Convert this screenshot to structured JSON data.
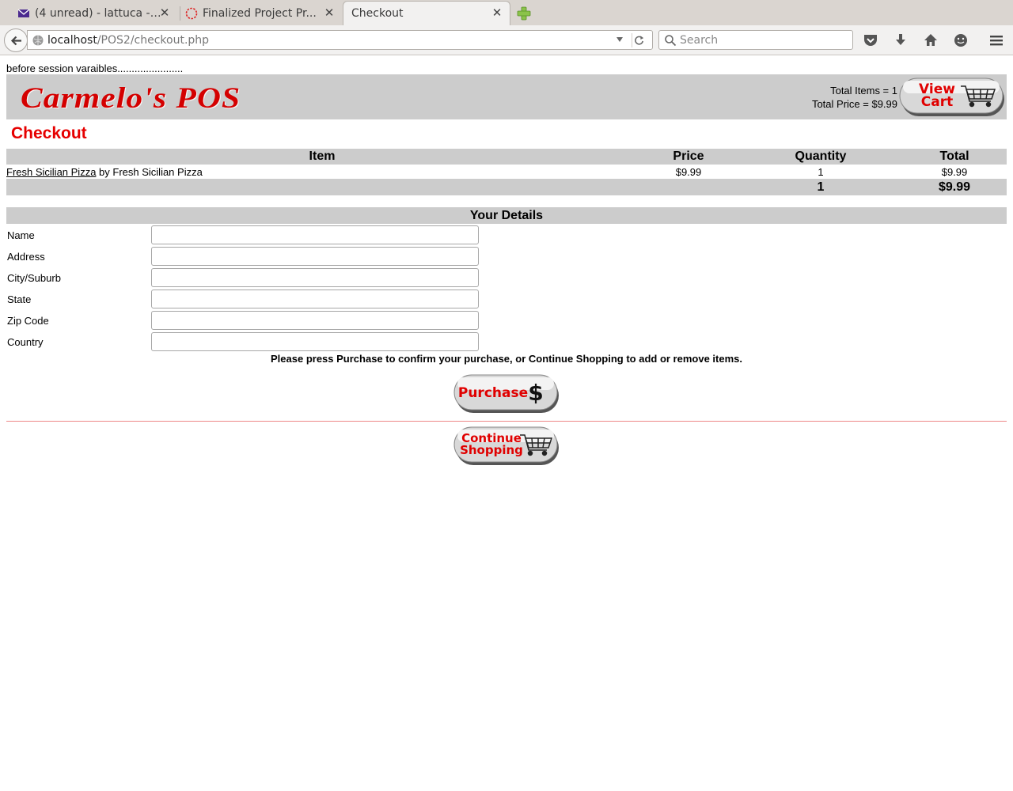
{
  "browser": {
    "tabs": [
      {
        "title": "(4 unread) - lattuca - ...",
        "icon": "mail-icon"
      },
      {
        "title": "Finalized Project Pr...",
        "icon": "loading-icon"
      },
      {
        "title": "Checkout",
        "icon": "none"
      }
    ],
    "url": {
      "host": "localhost",
      "path": "/POS2/checkout.php"
    },
    "search_placeholder": "Search"
  },
  "page": {
    "debug_text": "before session varaibles.......................",
    "logo": "Carmelo's POS",
    "cart": {
      "total_items": "Total Items = 1",
      "total_price": "Total Price = $9.99",
      "view_cart_line1": "View",
      "view_cart_line2": "Cart"
    },
    "title": "Checkout",
    "table": {
      "headers": {
        "item": "Item",
        "price": "Price",
        "quantity": "Quantity",
        "total": "Total"
      },
      "rows": [
        {
          "item_link": "Fresh Sicilian Pizza",
          "item_suffix": " by Fresh Sicilian Pizza",
          "price": "$9.99",
          "quantity": "1",
          "total": "$9.99"
        }
      ],
      "totals": {
        "quantity": "1",
        "total": "$9.99"
      }
    },
    "details": {
      "heading": "Your Details",
      "fields": [
        {
          "label": "Name",
          "value": ""
        },
        {
          "label": "Address",
          "value": ""
        },
        {
          "label": "City/Suburb",
          "value": ""
        },
        {
          "label": "State",
          "value": ""
        },
        {
          "label": "Zip Code",
          "value": ""
        },
        {
          "label": "Country",
          "value": ""
        }
      ]
    },
    "instruction": "Please press Purchase to confirm your purchase, or Continue Shopping to add or remove items.",
    "purchase_label": "Purchase",
    "purchase_symbol": "$",
    "continue_line1": "Continue",
    "continue_line2": "Shopping"
  },
  "colors": {
    "accent_red": "#e60000",
    "header_gray": "#cccccc"
  }
}
